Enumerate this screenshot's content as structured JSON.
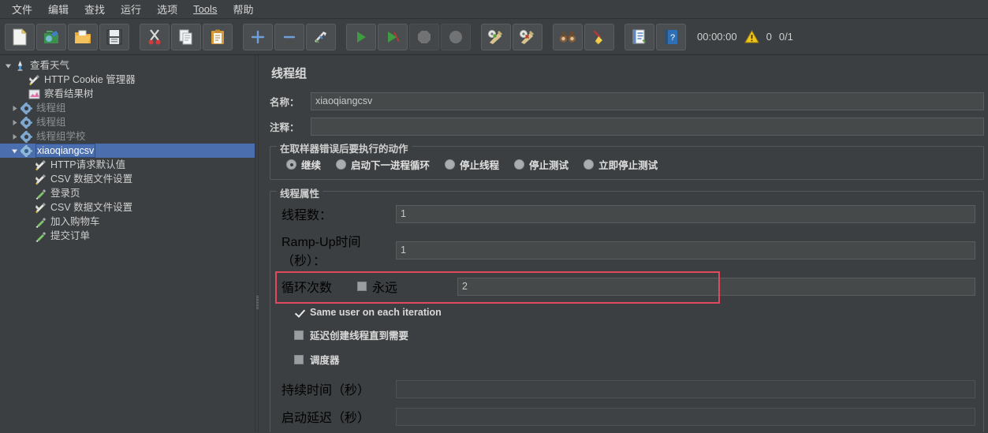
{
  "menubar": {
    "items": [
      {
        "label": "文件",
        "mnemonic": ""
      },
      {
        "label": "编辑",
        "mnemonic": ""
      },
      {
        "label": "查找",
        "mnemonic": ""
      },
      {
        "label": "运行",
        "mnemonic": ""
      },
      {
        "label": "选项",
        "mnemonic": ""
      },
      {
        "label": "Tools",
        "mnemonic": "T"
      },
      {
        "label": "帮助",
        "mnemonic": ""
      }
    ]
  },
  "toolbar": {
    "buttons": [
      {
        "name": "new-icon",
        "title": "新建"
      },
      {
        "name": "templates-icon",
        "title": "模板"
      },
      {
        "name": "open-icon",
        "title": "打开"
      },
      {
        "name": "save-icon",
        "title": "保存"
      },
      {
        "name": "cut-icon",
        "title": "剪切"
      },
      {
        "name": "copy-icon",
        "title": "复制"
      },
      {
        "name": "paste-icon",
        "title": "粘贴"
      },
      {
        "name": "expand-all-icon",
        "title": "展开"
      },
      {
        "name": "collapse-all-icon",
        "title": "折叠"
      },
      {
        "name": "toggle-icon",
        "title": "切换"
      },
      {
        "name": "start-icon",
        "title": "启动"
      },
      {
        "name": "start-no-pauses-icon",
        "title": "无间隔启动"
      },
      {
        "name": "stop-icon",
        "title": "停止"
      },
      {
        "name": "shutdown-icon",
        "title": "关闭"
      },
      {
        "name": "clear-icon",
        "title": "清除"
      },
      {
        "name": "clear-all-icon",
        "title": "清除全部"
      },
      {
        "name": "search-icon",
        "title": "搜索"
      },
      {
        "name": "reset-search-icon",
        "title": "重置搜索"
      },
      {
        "name": "function-helper-icon",
        "title": "函数助手对话框"
      },
      {
        "name": "help-icon",
        "title": "帮助"
      }
    ],
    "elapsed_time": "00:00:00",
    "warning_count": "0",
    "thread_count": "0/1",
    "warning_color": "#f0c419"
  },
  "tree": {
    "nodes": [
      {
        "label": "查看天气",
        "icon": "test-plan-icon",
        "depth": 0,
        "twist": "expanded",
        "selected": false,
        "dim": false
      },
      {
        "label": "HTTP Cookie 管理器",
        "icon": "config-element-icon",
        "depth": 1,
        "twist": "none",
        "selected": false,
        "dim": false
      },
      {
        "label": "察看结果树",
        "icon": "view-results-tree-icon",
        "depth": 1,
        "twist": "none",
        "selected": false,
        "dim": false
      },
      {
        "label": "线程组",
        "icon": "thread-group-icon",
        "depth": 1,
        "twist": "collapsed",
        "selected": false,
        "dim": true
      },
      {
        "label": "线程组",
        "icon": "thread-group-icon",
        "depth": 1,
        "twist": "collapsed",
        "selected": false,
        "dim": true
      },
      {
        "label": "线程组学校",
        "icon": "thread-group-icon",
        "depth": 1,
        "twist": "collapsed",
        "selected": false,
        "dim": true
      },
      {
        "label": "xiaoqiangcsv",
        "icon": "thread-group-icon",
        "depth": 1,
        "twist": "expanded",
        "selected": true,
        "dim": false
      },
      {
        "label": "HTTP请求默认值",
        "icon": "config-element-icon",
        "depth": 2,
        "twist": "none",
        "selected": false,
        "dim": false
      },
      {
        "label": "CSV 数据文件设置",
        "icon": "config-element-icon",
        "depth": 2,
        "twist": "none",
        "selected": false,
        "dim": false
      },
      {
        "label": "登录页",
        "icon": "http-sampler-icon",
        "depth": 2,
        "twist": "none",
        "selected": false,
        "dim": false
      },
      {
        "label": "CSV 数据文件设置",
        "icon": "config-element-icon",
        "depth": 2,
        "twist": "none",
        "selected": false,
        "dim": false
      },
      {
        "label": "加入购物车",
        "icon": "http-sampler-icon",
        "depth": 2,
        "twist": "none",
        "selected": false,
        "dim": false
      },
      {
        "label": "提交订单",
        "icon": "http-sampler-icon",
        "depth": 2,
        "twist": "none",
        "selected": false,
        "dim": false
      }
    ],
    "selection_color": "#4b6eaf"
  },
  "panel": {
    "title": "线程组",
    "name_label": "名称：",
    "name_value": "xiaoqiangcsv",
    "comment_label": "注释：",
    "comment_value": "",
    "error_action": {
      "legend": "在取样器错误后要执行的动作",
      "options": [
        {
          "label": "继续",
          "selected": true
        },
        {
          "label": "启动下一进程循环",
          "selected": false
        },
        {
          "label": "停止线程",
          "selected": false
        },
        {
          "label": "停止测试",
          "selected": false
        },
        {
          "label": "立即停止测试",
          "selected": false
        }
      ]
    },
    "thread_properties": {
      "legend": "线程属性",
      "num_threads_label": "线程数：",
      "num_threads_value": "1",
      "ramp_up_label": "Ramp-Up时间（秒）：",
      "ramp_up_value": "1",
      "loop_count_label": "循环次数",
      "loop_forever_label": "永远",
      "loop_forever_checked": false,
      "loop_count_value": "2",
      "highlight_color": "#e04a5c",
      "same_user_label": "Same user on each iteration",
      "same_user_checked": true,
      "delayed_start_label": "延迟创建线程直到需要",
      "delayed_start_checked": false,
      "scheduler_label": "调度器",
      "scheduler_checked": false,
      "duration_label": "持续时间（秒）",
      "duration_value": "",
      "startup_delay_label": "启动延迟（秒）",
      "startup_delay_value": ""
    }
  }
}
